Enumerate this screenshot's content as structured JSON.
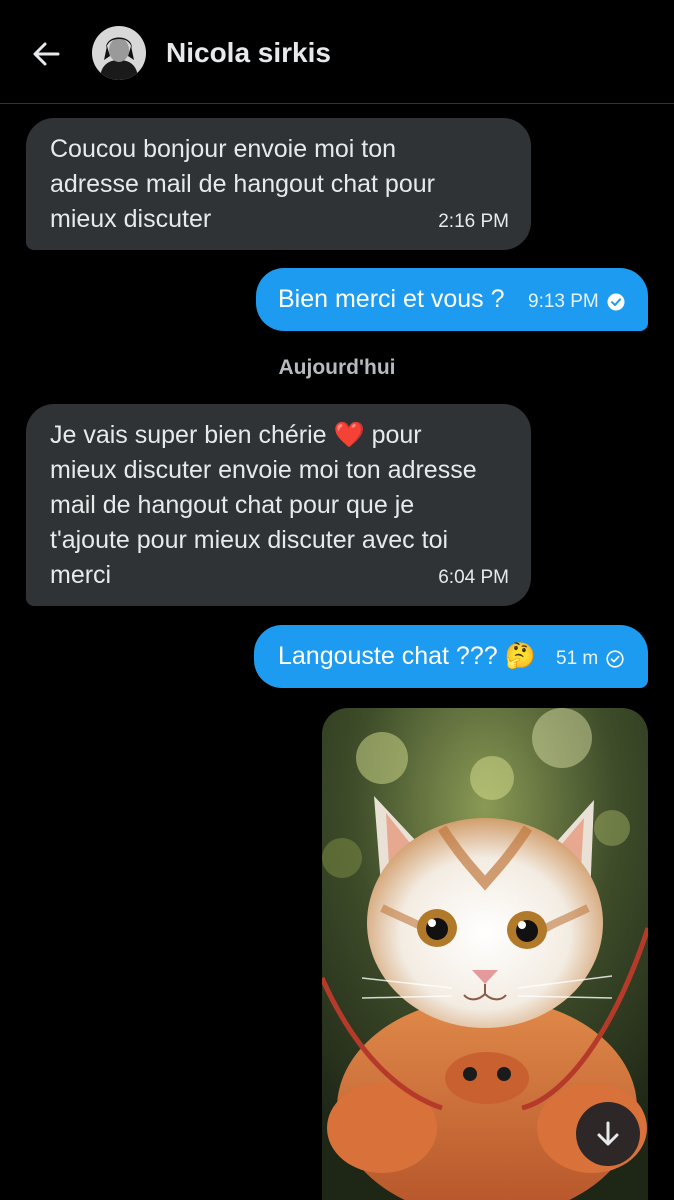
{
  "header": {
    "contact_name": "Nicola sirkis"
  },
  "messages": [
    {
      "direction": "in",
      "lines": [
        "Coucou bonjour envoie moi ton",
        "adresse mail de hangout chat pour",
        "mieux discuter"
      ],
      "time": "2:16 PM"
    },
    {
      "direction": "out",
      "text": "Bien merci et vous ?",
      "time": "9:13 PM",
      "status": "read"
    },
    {
      "direction": "in",
      "lines": [
        "Je vais super bien chérie",
        "pour",
        "mieux discuter envoie moi ton adresse",
        "mail de hangout chat pour que je",
        "t'ajoute pour mieux discuter avec toi",
        "merci"
      ],
      "emoji": "❤️",
      "time": "6:04 PM"
    },
    {
      "direction": "out",
      "text": "Langouste chat ???",
      "emoji": "🤔",
      "time": "51 m",
      "status": "sent"
    }
  ],
  "date_separator": "Aujourd'hui",
  "media": {
    "icon": "cat-lobster-image"
  },
  "colors": {
    "background": "#000000",
    "incoming_bubble": "#2f3336",
    "outgoing_bubble": "#1d9bf0"
  }
}
